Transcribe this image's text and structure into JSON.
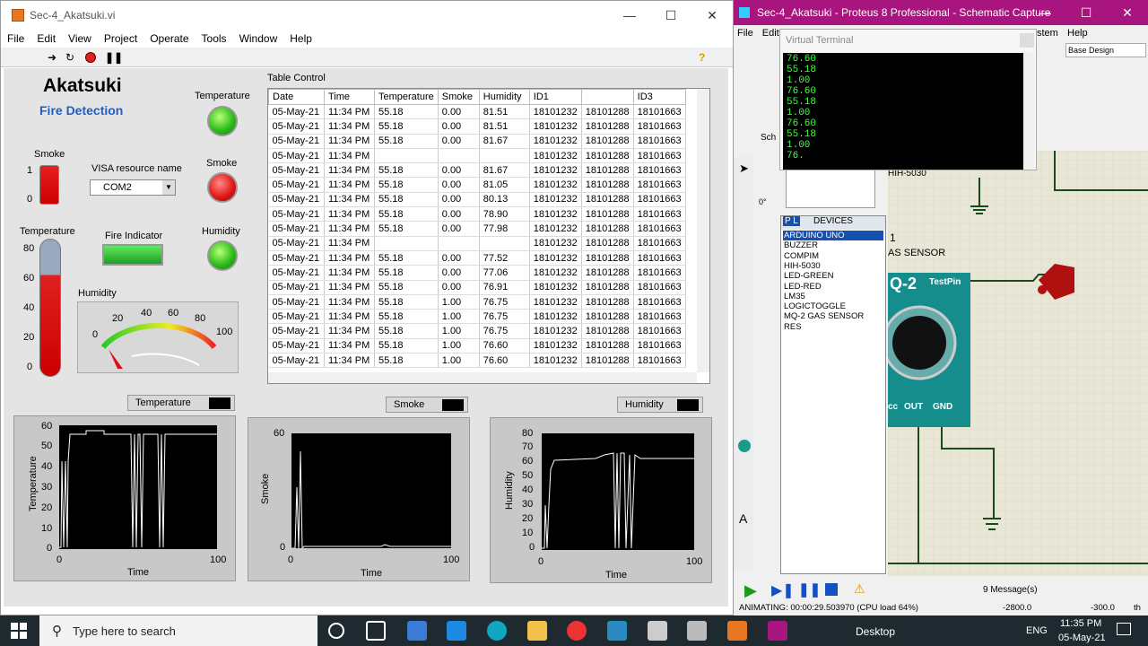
{
  "lv": {
    "title": "Sec-4_Akatsuki.vi",
    "menu": [
      "File",
      "Edit",
      "View",
      "Project",
      "Operate",
      "Tools",
      "Window",
      "Help"
    ],
    "heading": "Akatsuki",
    "subheading": "Fire Detection",
    "smoke_label": "Smoke",
    "smoke_ticks": [
      "1",
      "0"
    ],
    "visa_label": "VISA resource name",
    "visa_value": "COM2",
    "led_temp_label": "Temperature",
    "led_smoke_label": "Smoke",
    "led_hum_label": "Humidity",
    "fire_label": "Fire Indicator",
    "therm_label": "Temperature",
    "therm_ticks": [
      "80",
      "60",
      "40",
      "20",
      "0"
    ],
    "hum_label": "Humidity",
    "gauge_ticks": [
      "0",
      "20",
      "40",
      "60",
      "80",
      "100"
    ],
    "table_label": "Table Control",
    "table_headers": [
      "Date",
      "Time",
      "Temperature",
      "Smoke",
      "Humidity",
      "ID1",
      "",
      "ID3"
    ],
    "rows": [
      [
        "05-May-21",
        "11:34 PM",
        "55.18",
        "0.00",
        "81.51",
        "18101232",
        "18101288",
        "18101663"
      ],
      [
        "05-May-21",
        "11:34 PM",
        "55.18",
        "0.00",
        "81.51",
        "18101232",
        "18101288",
        "18101663"
      ],
      [
        "05-May-21",
        "11:34 PM",
        "55.18",
        "0.00",
        "81.67",
        "18101232",
        "18101288",
        "18101663"
      ],
      [
        "05-May-21",
        "11:34 PM",
        "",
        "",
        "",
        "18101232",
        "18101288",
        "18101663"
      ],
      [
        "05-May-21",
        "11:34 PM",
        "55.18",
        "0.00",
        "81.67",
        "18101232",
        "18101288",
        "18101663"
      ],
      [
        "05-May-21",
        "11:34 PM",
        "55.18",
        "0.00",
        "81.05",
        "18101232",
        "18101288",
        "18101663"
      ],
      [
        "05-May-21",
        "11:34 PM",
        "55.18",
        "0.00",
        "80.13",
        "18101232",
        "18101288",
        "18101663"
      ],
      [
        "05-May-21",
        "11:34 PM",
        "55.18",
        "0.00",
        "78.90",
        "18101232",
        "18101288",
        "18101663"
      ],
      [
        "05-May-21",
        "11:34 PM",
        "55.18",
        "0.00",
        "77.98",
        "18101232",
        "18101288",
        "18101663"
      ],
      [
        "05-May-21",
        "11:34 PM",
        "",
        "",
        "",
        "18101232",
        "18101288",
        "18101663"
      ],
      [
        "05-May-21",
        "11:34 PM",
        "55.18",
        "0.00",
        "77.52",
        "18101232",
        "18101288",
        "18101663"
      ],
      [
        "05-May-21",
        "11:34 PM",
        "55.18",
        "0.00",
        "77.06",
        "18101232",
        "18101288",
        "18101663"
      ],
      [
        "05-May-21",
        "11:34 PM",
        "55.18",
        "0.00",
        "76.91",
        "18101232",
        "18101288",
        "18101663"
      ],
      [
        "05-May-21",
        "11:34 PM",
        "55.18",
        "1.00",
        "76.75",
        "18101232",
        "18101288",
        "18101663"
      ],
      [
        "05-May-21",
        "11:34 PM",
        "55.18",
        "1.00",
        "76.75",
        "18101232",
        "18101288",
        "18101663"
      ],
      [
        "05-May-21",
        "11:34 PM",
        "55.18",
        "1.00",
        "76.75",
        "18101232",
        "18101288",
        "18101663"
      ],
      [
        "05-May-21",
        "11:34 PM",
        "55.18",
        "1.00",
        "76.60",
        "18101232",
        "18101288",
        "18101663"
      ],
      [
        "05-May-21",
        "11:34 PM",
        "55.18",
        "1.00",
        "76.60",
        "18101232",
        "18101288",
        "18101663"
      ]
    ],
    "g1": {
      "name": "Temperature",
      "ylabel": "Temperature",
      "xlabel": "Time",
      "yticks": [
        "60",
        "50",
        "40",
        "30",
        "20",
        "10",
        "0"
      ],
      "xticks": [
        "0",
        "100"
      ]
    },
    "g2": {
      "name": "Smoke",
      "ylabel": "Smoke",
      "xlabel": "Time",
      "yticks": [
        "60",
        "0"
      ],
      "xticks": [
        "0",
        "100"
      ]
    },
    "g3": {
      "name": "Humidity",
      "ylabel": "Humidity",
      "xlabel": "Time",
      "yticks": [
        "80",
        "70",
        "60",
        "50",
        "40",
        "30",
        "20",
        "10",
        "0"
      ],
      "xticks": [
        "0",
        "100"
      ]
    }
  },
  "pr": {
    "title": "Sec-4_Akatsuki - Proteus 8 Professional - Schematic Capture",
    "menu_file": "File",
    "menu_edit": "Edit",
    "menu_stem": "stem",
    "menu_help": "Help",
    "vt_title": "Virtual Terminal",
    "vt_lines": "76.60\n55.18\n1.00\n76.60\n55.18\n1.00\n76.60\n55.18\n1.00\n76.",
    "design": "Base Design",
    "devices_head": "DEVICES",
    "pl": "P  L",
    "devices": [
      "ARDUINO UNO",
      "BUZZER",
      "COMPIM",
      "HIH-5030",
      "LED-GREEN",
      "LED-RED",
      "LM35",
      "LOGICTOGGLE",
      "MQ-2 GAS SENSOR",
      "RES"
    ],
    "sch_tab": "Sch",
    "angle": "0°",
    "hih": "HIH-5030",
    "one": "1",
    "gas": "AS SENSOR",
    "q2": "Q-2",
    "testpin": "TestPin",
    "pins": [
      "cc",
      "OUT",
      "GND"
    ],
    "messages": "9 Message(s)",
    "animating": "ANIMATING: 00:00:29.503970 (CPU load 64%)",
    "coord1": "-2800.0",
    "coord2": "-300.0",
    "th": "th"
  },
  "taskbar": {
    "search": "Type here to search",
    "desktop": "Desktop",
    "lang": "ENG",
    "time": "11:35 PM",
    "date": "05-May-21"
  }
}
